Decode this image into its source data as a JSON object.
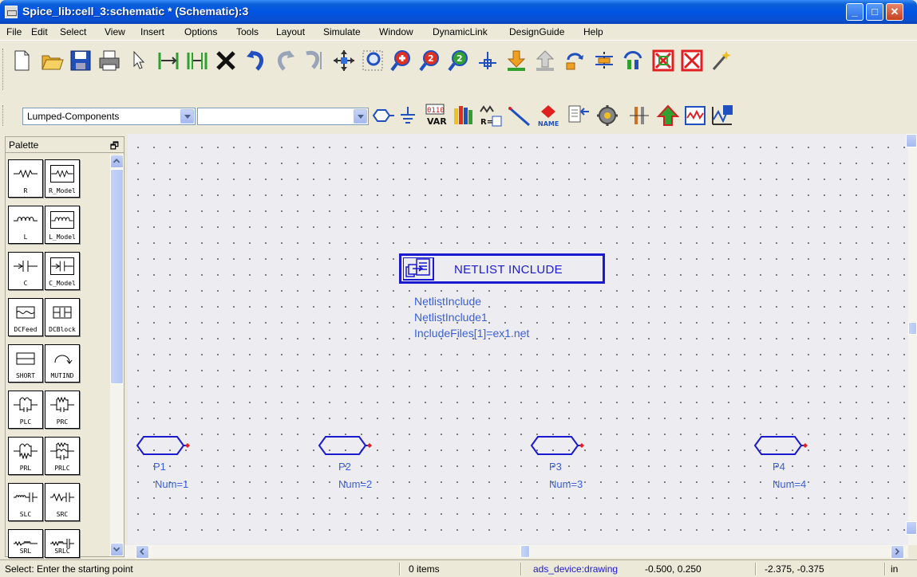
{
  "window": {
    "title": "Spice_lib:cell_3:schematic * (Schematic):3",
    "min_glyph": "_",
    "max_glyph": "□",
    "close_glyph": "✕"
  },
  "menu": [
    "File",
    "Edit",
    "Select",
    "View",
    "Insert",
    "Options",
    "Tools",
    "Layout",
    "Simulate",
    "Window",
    "DynamicLink",
    "DesignGuide",
    "Help"
  ],
  "toolbar2": {
    "library_combo": "Lumped-Components",
    "component_combo": "",
    "var_label_top": "0110",
    "var_label_bottom": "VAR",
    "name_label": "NAME",
    "r_label": "R="
  },
  "palette": {
    "title": "Palette",
    "float_glyph": "🗗",
    "items": [
      "R",
      "R_Model",
      "L",
      "L_Model",
      "C",
      "C_Model",
      "DCFeed",
      "DCBlock",
      "SHORT",
      "MUTIND",
      "PLC",
      "PRC",
      "PRL",
      "PRLC",
      "SLC",
      "SRC",
      "SRL",
      "SRLC"
    ]
  },
  "schematic": {
    "component": {
      "box_label": "NETLIST INCLUDE",
      "type": "NetlistInclude",
      "instance": "NetlistInclude1",
      "param": "IncludeFiles[1]=ex1.net"
    },
    "ports": [
      {
        "name": "P1",
        "num": "Num=1"
      },
      {
        "name": "P2",
        "num": "Num=2"
      },
      {
        "name": "P3",
        "num": "Num=3"
      },
      {
        "name": "P4",
        "num": "Num=4"
      }
    ]
  },
  "status": {
    "message": "Select: Enter the starting point",
    "items": "0 items",
    "layer": "ads_device:drawing",
    "coord1": "-0.500, 0.250",
    "coord2": "-2.375, -0.375",
    "units": "in"
  },
  "colors": {
    "schematic_blue": "#1a1ad0",
    "label_blue": "#3a60d8",
    "port_red": "#e02020"
  }
}
